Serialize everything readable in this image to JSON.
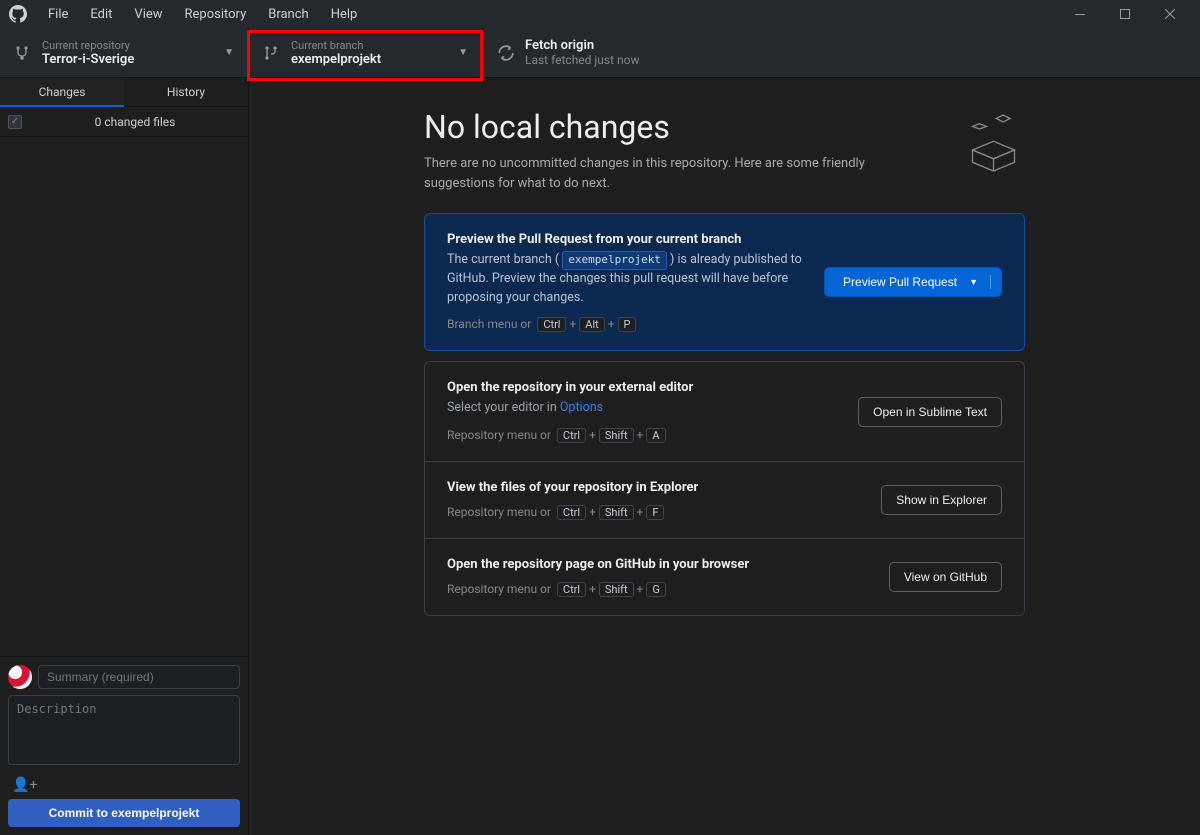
{
  "menu": [
    "File",
    "Edit",
    "View",
    "Repository",
    "Branch",
    "Help"
  ],
  "toolbar": {
    "repo": {
      "label": "Current repository",
      "value": "Terror-i-Sverige"
    },
    "branch": {
      "label": "Current branch",
      "value": "exempelprojekt"
    },
    "fetch": {
      "label": "Fetch origin",
      "sub": "Last fetched just now"
    }
  },
  "sidebar": {
    "tabs": {
      "changes": "Changes",
      "history": "History"
    },
    "changed_files": "0 changed files",
    "summary_placeholder": "Summary (required)",
    "description_placeholder": "Description",
    "commit_button": "Commit to exempelprojekt"
  },
  "hero": {
    "title": "No local changes",
    "subtitle": "There are no uncommitted changes in this repository. Here are some friendly suggestions for what to do next."
  },
  "cards": {
    "pr": {
      "title": "Preview the Pull Request from your current branch",
      "desc_pre": "The current branch (",
      "branch": "exempelprojekt",
      "desc_mid": ") is already published to GitHub. Preview the changes this pull request will have before proposing your changes.",
      "hotkey_label": "Branch menu or",
      "k1": "Ctrl",
      "k2": "Alt",
      "k3": "P",
      "button": "Preview Pull Request"
    },
    "editor": {
      "title": "Open the repository in your external editor",
      "desc": "Select your editor in ",
      "options": "Options",
      "hotkey_label": "Repository menu or",
      "k1": "Ctrl",
      "k2": "Shift",
      "k3": "A",
      "button": "Open in Sublime Text"
    },
    "explorer": {
      "title": "View the files of your repository in Explorer",
      "hotkey_label": "Repository menu or",
      "k1": "Ctrl",
      "k2": "Shift",
      "k3": "F",
      "button": "Show in Explorer"
    },
    "github": {
      "title": "Open the repository page on GitHub in your browser",
      "hotkey_label": "Repository menu or",
      "k1": "Ctrl",
      "k2": "Shift",
      "k3": "G",
      "button": "View on GitHub"
    }
  },
  "plus": "+"
}
